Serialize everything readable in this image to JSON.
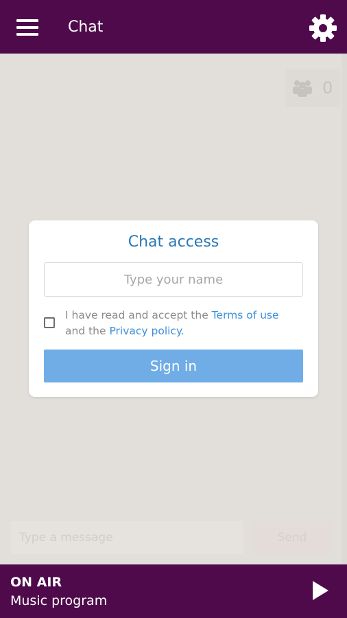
{
  "header": {
    "title": "Chat",
    "menu_icon": "hamburger-menu-icon",
    "settings_icon": "gear-icon"
  },
  "users": {
    "icon": "users-group-icon",
    "count": "0"
  },
  "dialog": {
    "title": "Chat access",
    "name_placeholder": "Type your name",
    "terms_prefix": "I have read and accept the ",
    "terms_link": "Terms of use",
    "terms_middle": " and the ",
    "privacy_link": "Privacy policy",
    "terms_suffix": ".",
    "signin_label": "Sign in",
    "checked": false
  },
  "message": {
    "placeholder": "Type a message",
    "send_label": "Send"
  },
  "player": {
    "status": "ON AIR",
    "program": "Music program",
    "play_icon": "play-icon"
  },
  "colors": {
    "brand": "#4e0a4b",
    "background": "#e2dfdb",
    "link": "#3c8fdc",
    "title": "#2978b5",
    "button": "#70ade6"
  }
}
